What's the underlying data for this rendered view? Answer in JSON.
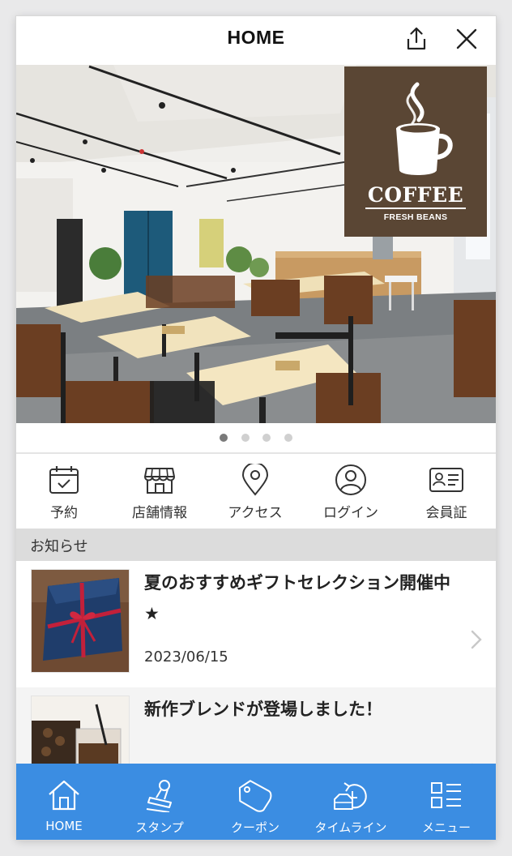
{
  "header": {
    "title": "HOME",
    "share_icon": "share-icon",
    "close_icon": "close-icon"
  },
  "hero": {
    "logo_text": "COFFEE",
    "logo_sub": "FRESH BEANS",
    "slide_count": 4,
    "active_slide": 1
  },
  "quick_menu": [
    {
      "label": "予約",
      "icon": "calendar-icon"
    },
    {
      "label": "店舗情報",
      "icon": "store-icon"
    },
    {
      "label": "アクセス",
      "icon": "map-pin-icon"
    },
    {
      "label": "ログイン",
      "icon": "user-icon"
    },
    {
      "label": "会員証",
      "icon": "member-card-icon"
    }
  ],
  "news_section": {
    "title": "お知らせ"
  },
  "news": [
    {
      "title": "夏のおすすめギフトセレクション開催中★",
      "date": "2023/06/15"
    },
    {
      "title": "新作ブレンドが登場しました！",
      "date": ""
    }
  ],
  "tabbar": [
    {
      "label": "HOME",
      "icon": "home-icon"
    },
    {
      "label": "スタンプ",
      "icon": "stamp-icon"
    },
    {
      "label": "クーポン",
      "icon": "coupon-icon"
    },
    {
      "label": "タイムライン",
      "icon": "timeline-icon"
    },
    {
      "label": "メニュー",
      "icon": "menu-icon"
    }
  ],
  "colors": {
    "accent": "#3b8de2",
    "logo_bg": "#5a4634"
  }
}
